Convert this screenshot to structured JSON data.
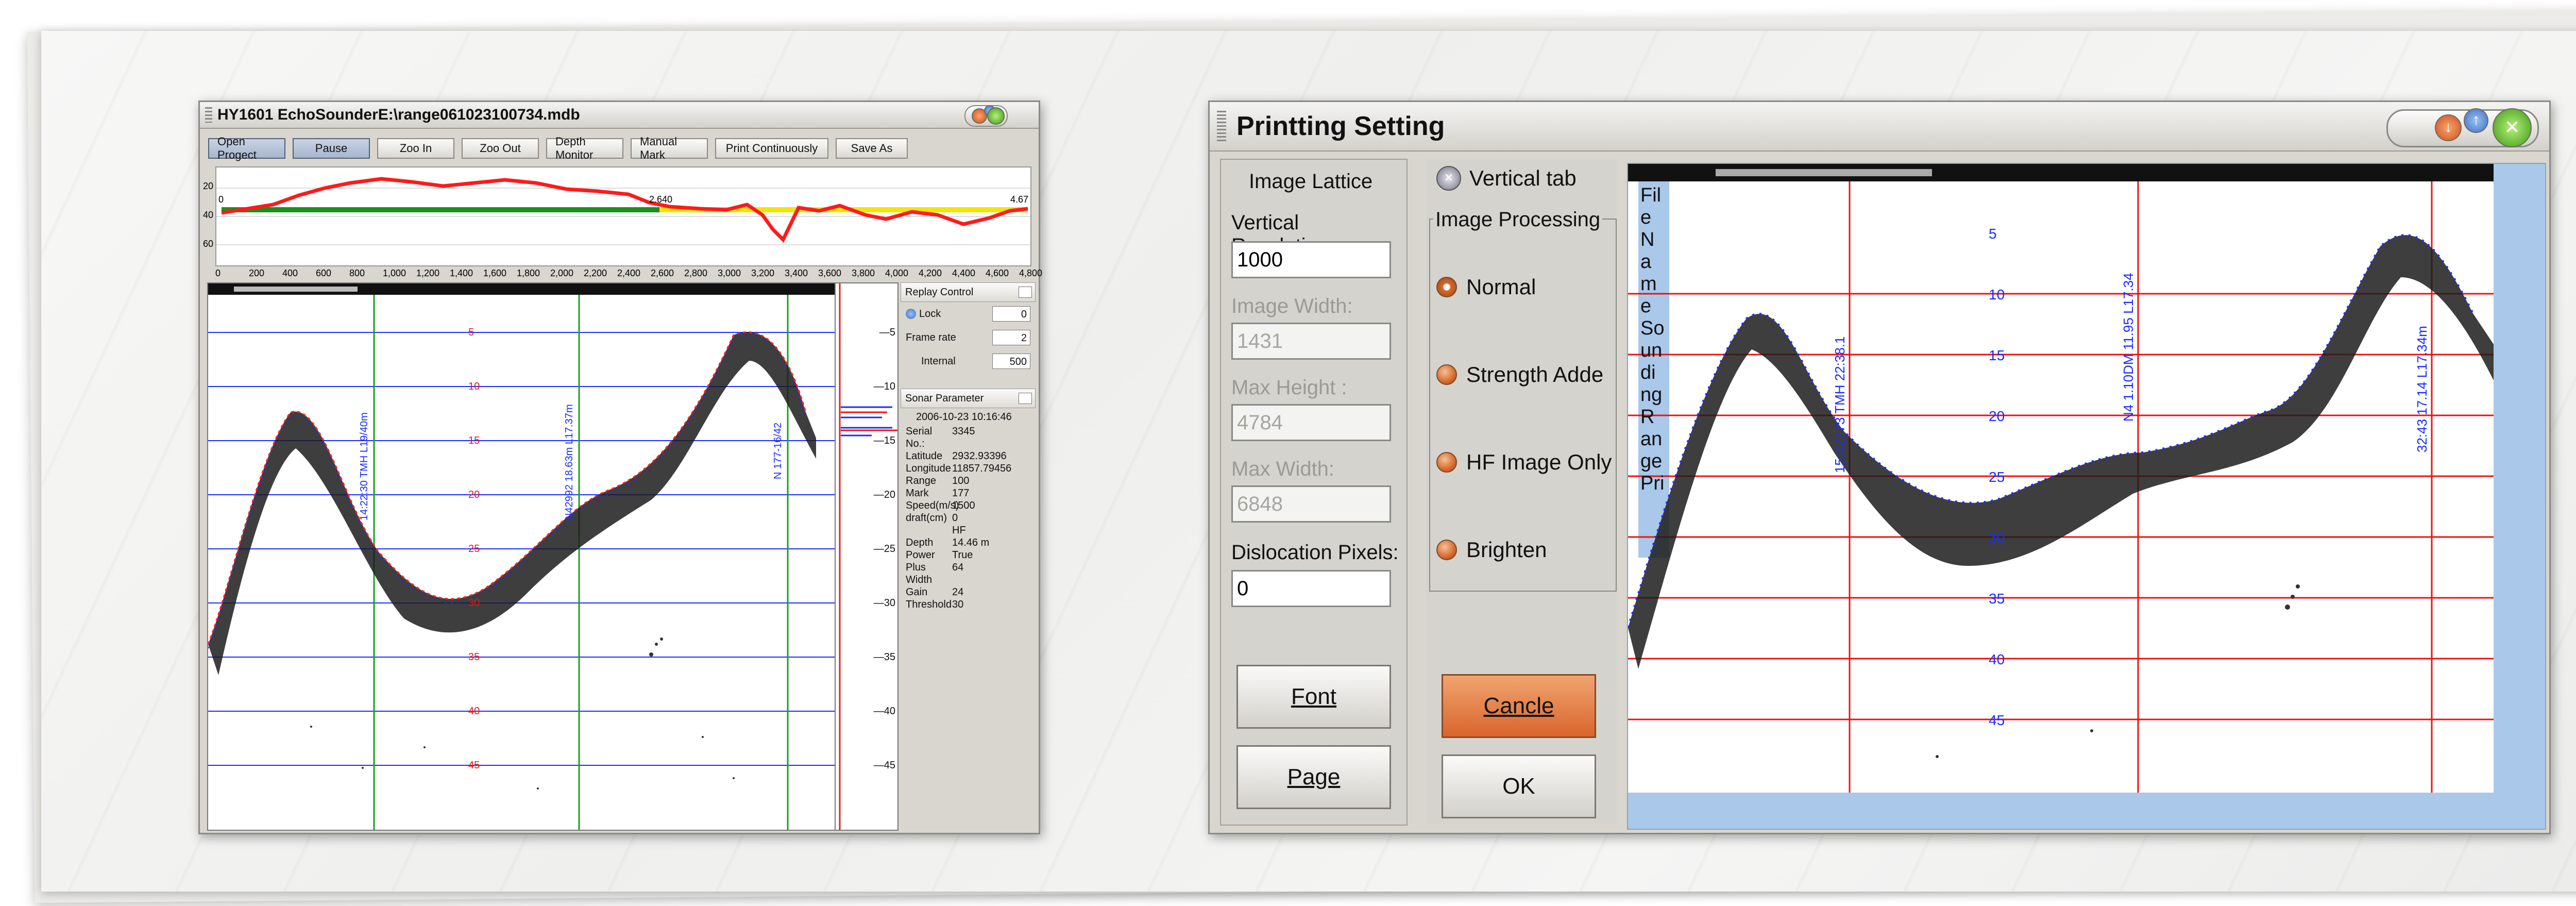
{
  "echo_window": {
    "title": "HY1601 EchoSounderE:\\range061023100734.mdb",
    "toolbar": [
      "Open Progect",
      "Pause",
      "Zoo In",
      "Zoo Out",
      "Depth Monitor",
      "Manual Mark",
      "Print Continuously",
      "Save As"
    ],
    "active_button": "Pause",
    "strip_y_ticks": [
      "20",
      "40",
      "60"
    ],
    "strip_labels": {
      "left": "0",
      "mid": "2.640",
      "right": "4.67"
    },
    "ruler_ticks": [
      "0",
      "200",
      "400",
      "600",
      "800",
      "1,000",
      "1,200",
      "1,400",
      "1,600",
      "1,800",
      "2,000",
      "2,200",
      "2,400",
      "2,600",
      "2,800",
      "3,000",
      "3,200",
      "3,400",
      "3,600",
      "3,800",
      "4,000",
      "4,200",
      "4,400",
      "4,600",
      "4,800"
    ],
    "depth_labels": [
      "5",
      "10",
      "15",
      "20",
      "25",
      "30",
      "35",
      "40",
      "45"
    ],
    "side_depth_ticks": [
      "5",
      "10",
      "15",
      "20",
      "25",
      "30",
      "35",
      "40",
      "45"
    ],
    "vertical_marks": [
      "14:22:30  TMH  L19/40m",
      "N42992  18.63m  L17.37m",
      "N  177-16/42"
    ],
    "replay": {
      "title": "Replay Control",
      "lock_label": "Lock",
      "lock_value": "0",
      "frame_rate_label": "Frame rate",
      "frame_rate_value": "2",
      "internal_label": "Internal",
      "internal_value": "500"
    },
    "sonar": {
      "title": "Sonar Parameter",
      "timestamp": "2006-10-23 10:16:46",
      "rows": [
        {
          "k": "Serial No.:",
          "v": "3345"
        },
        {
          "k": "Latitude",
          "v": "2932.93396"
        },
        {
          "k": "Longitude",
          "v": "11857.79456"
        },
        {
          "k": "Range",
          "v": "100"
        },
        {
          "k": "Mark",
          "v": "177"
        },
        {
          "k": "Speed(m/s)",
          "v": "1500"
        },
        {
          "k": "draft(cm)",
          "v": "0"
        },
        {
          "k": "",
          "v": "HF"
        },
        {
          "k": "Depth",
          "v": "14.46 m"
        },
        {
          "k": "Power",
          "v": "True"
        },
        {
          "k": "Plus Width",
          "v": "64"
        },
        {
          "k": "Gain",
          "v": "24"
        },
        {
          "k": "Threshold",
          "v": "30"
        }
      ]
    }
  },
  "print_window": {
    "title": "Printting Setting",
    "image_lattice": "Image Lattice",
    "vertical_resolution_label": "Vertical Resolution:",
    "vertical_resolution_value": "1000",
    "image_width_label": "Image Width:",
    "image_width_value": "1431",
    "max_height_label": "Max Height :",
    "max_height_value": "4784",
    "max_width_label": "Max Width:",
    "max_width_value": "6848",
    "dislocation_label": "Dislocation Pixels:",
    "dislocation_value": "0",
    "font_button": "Font",
    "page_button": "Page",
    "vertical_tab": "Vertical tab",
    "image_processing": "Image Processing",
    "options": [
      "Normal",
      "Strength Adde",
      "HF Image Only",
      "Brighten"
    ],
    "selected_option": "Normal",
    "cancel_button": "Cancle",
    "ok_button": "OK",
    "preview_side_text": [
      "Fil",
      "e",
      "N",
      "a",
      "m",
      "e",
      "So",
      "un",
      "di",
      "ng",
      "R",
      "an",
      "ge",
      "Pri"
    ],
    "preview_depth_labels": [
      "5",
      "10",
      "15",
      "20",
      "25",
      "30",
      "35",
      "40",
      "45"
    ],
    "preview_marks": [
      "15:42773  TMH  22:38.1",
      "N4  1.10DM  11.95  L17.34",
      "32:43  17.14  L17.34m"
    ]
  },
  "colors": {
    "echo_red": "#ff1a1a",
    "echo_blue": "#1a2cff",
    "depth_line": "#ff2020",
    "green": "#199019",
    "yellow": "#f4e500"
  }
}
